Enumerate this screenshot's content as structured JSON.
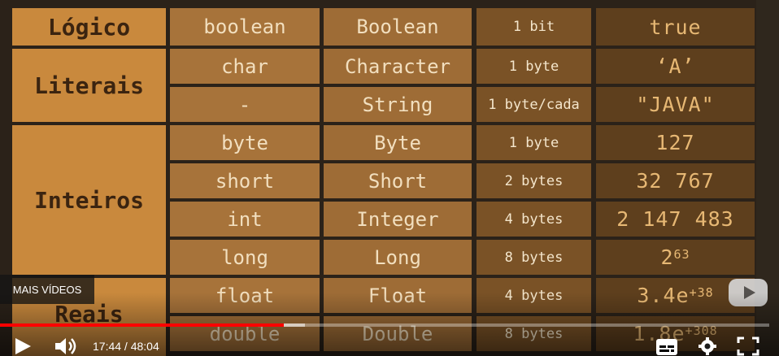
{
  "table": {
    "categories": [
      "Lógico",
      "Literais",
      "Inteiros",
      "Reais"
    ],
    "rows": [
      {
        "primitive": "boolean",
        "wrapper": "Boolean",
        "size": "1 bit",
        "value": "true"
      },
      {
        "primitive": "char",
        "wrapper": "Character",
        "size": "1 byte",
        "value": "‘A’"
      },
      {
        "primitive": "-",
        "wrapper": "String",
        "size": "1 byte/cada",
        "value": "\"JAVA\""
      },
      {
        "primitive": "byte",
        "wrapper": "Byte",
        "size": "1 byte",
        "value": "127"
      },
      {
        "primitive": "short",
        "wrapper": "Short",
        "size": "2 bytes",
        "value": "32 767"
      },
      {
        "primitive": "int",
        "wrapper": "Integer",
        "size": "4 bytes",
        "value": "2 147 483"
      },
      {
        "primitive": "long",
        "wrapper": "Long",
        "size": "8 bytes",
        "value_base": "2",
        "value_exp": "63"
      },
      {
        "primitive": "float",
        "wrapper": "Float",
        "size": "4 bytes",
        "value_base": "3.4e",
        "value_exp": "+38"
      },
      {
        "primitive": "double",
        "wrapper": "Double",
        "size": "8 bytes",
        "value_base": "1.8e",
        "value_exp": "+308"
      }
    ]
  },
  "player": {
    "more_videos": "MAIS VÍDEOS",
    "time": "17:44 / 48:04",
    "progress_fraction": 0.363,
    "icons": [
      "play-icon",
      "volume-icon",
      "subtitles-icon",
      "settings-icon",
      "fullscreen-icon",
      "youtube-logo-icon"
    ]
  }
}
